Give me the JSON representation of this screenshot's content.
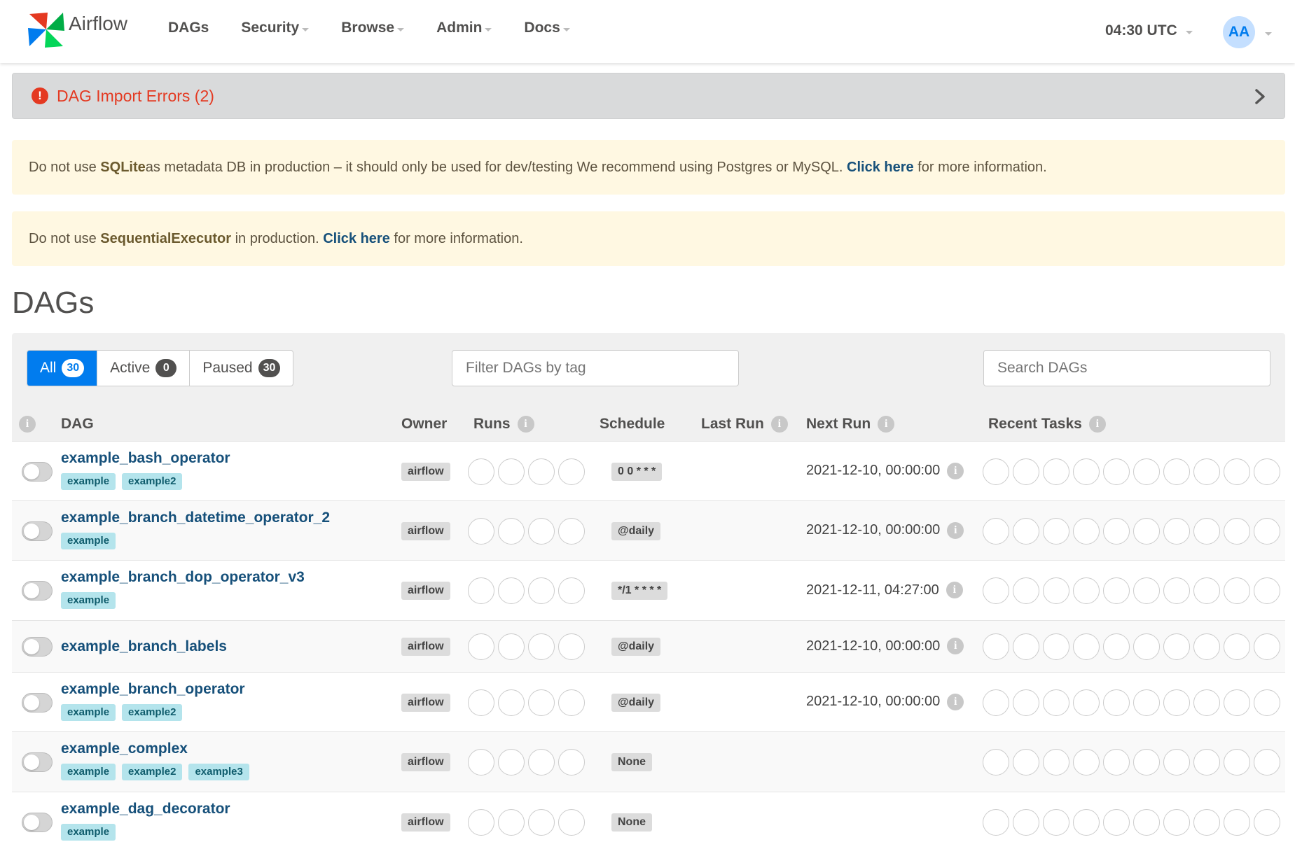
{
  "brand": {
    "name": "Airflow"
  },
  "nav": [
    "DAGs",
    "Security",
    "Browse",
    "Admin",
    "Docs"
  ],
  "clock": "04:30 UTC",
  "user_initials": "AA",
  "import_errors": {
    "label": "DAG Import Errors (2)",
    "icon": "!"
  },
  "alerts": {
    "sqlite": {
      "pre": "Do not use ",
      "bold": "SQLite",
      "mid": " as metadata DB in production – it should only be used for dev/testing We recommend using Postgres or MySQL. ",
      "link": "Click here",
      "post": " for more information."
    },
    "executor": {
      "pre": "Do not use ",
      "bold": "SequentialExecutor",
      "mid": " in production. ",
      "link": "Click here",
      "post": " for more information."
    }
  },
  "page_title": "DAGs",
  "filters": {
    "all_label": "All",
    "all_count": "30",
    "active_label": "Active",
    "active_count": "0",
    "paused_label": "Paused",
    "paused_count": "30"
  },
  "tag_filter_placeholder": "Filter DAGs by tag",
  "search_placeholder": "Search DAGs",
  "columns": {
    "dag": "DAG",
    "owner": "Owner",
    "runs": "Runs",
    "schedule": "Schedule",
    "last_run": "Last Run",
    "next_run": "Next Run",
    "recent_tasks": "Recent Tasks"
  },
  "info_glyph": "i",
  "dags": [
    {
      "name": "example_bash_operator",
      "tags": [
        "example",
        "example2"
      ],
      "owner": "airflow",
      "schedule": "0 0 * * *",
      "next_run": "2021-12-10, 00:00:00"
    },
    {
      "name": "example_branch_datetime_operator_2",
      "tags": [
        "example"
      ],
      "owner": "airflow",
      "schedule": "@daily",
      "next_run": "2021-12-10, 00:00:00"
    },
    {
      "name": "example_branch_dop_operator_v3",
      "tags": [
        "example"
      ],
      "owner": "airflow",
      "schedule": "*/1 * * * *",
      "next_run": "2021-12-11, 04:27:00"
    },
    {
      "name": "example_branch_labels",
      "tags": [],
      "owner": "airflow",
      "schedule": "@daily",
      "next_run": "2021-12-10, 00:00:00"
    },
    {
      "name": "example_branch_operator",
      "tags": [
        "example",
        "example2"
      ],
      "owner": "airflow",
      "schedule": "@daily",
      "next_run": "2021-12-10, 00:00:00"
    },
    {
      "name": "example_complex",
      "tags": [
        "example",
        "example2",
        "example3"
      ],
      "owner": "airflow",
      "schedule": "None",
      "next_run": ""
    },
    {
      "name": "example_dag_decorator",
      "tags": [
        "example"
      ],
      "owner": "airflow",
      "schedule": "None",
      "next_run": ""
    }
  ]
}
